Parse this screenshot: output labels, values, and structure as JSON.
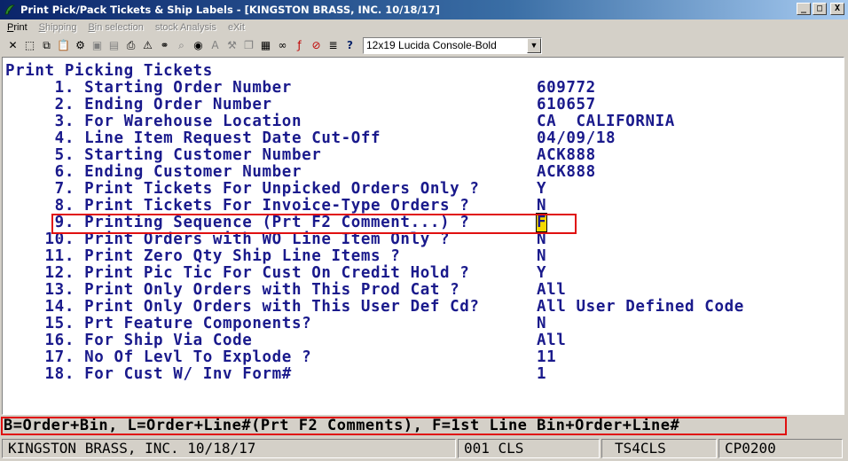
{
  "window": {
    "title": "Print Pick/Pack Tickets & Ship Labels - [KINGSTON BRASS, INC. 10/18/17]",
    "min": "_",
    "max": "□",
    "close": "X"
  },
  "menu": [
    {
      "label": "Print",
      "enabled": true
    },
    {
      "label": "Shipping",
      "enabled": false
    },
    {
      "label": "Bin selection",
      "enabled": false
    },
    {
      "label": "stock Analysis",
      "enabled": false
    },
    {
      "label": "eXit",
      "enabled": false
    }
  ],
  "toolbar": {
    "font_select_value": "12x19 Lucida Console-Bold",
    "buttons": [
      {
        "icon": "close-x-icon",
        "glyph": "✕"
      },
      {
        "icon": "select-box-icon",
        "glyph": "⬚"
      },
      {
        "icon": "copy-icon",
        "glyph": "⧉"
      },
      {
        "icon": "paste-icon",
        "glyph": "📋"
      },
      {
        "icon": "settings-gear-icon",
        "glyph": "⚙"
      },
      {
        "icon": "save-icon",
        "glyph": "▣"
      },
      {
        "icon": "document-icon",
        "glyph": "▤"
      },
      {
        "icon": "print-icon",
        "glyph": "⎙"
      },
      {
        "icon": "warning-icon",
        "glyph": "⚠"
      },
      {
        "icon": "binoculars-icon",
        "glyph": "⚭"
      },
      {
        "icon": "search-icon",
        "glyph": "⌕"
      },
      {
        "icon": "globe-icon",
        "glyph": "◉"
      },
      {
        "icon": "italic-font-icon",
        "glyph": "A"
      },
      {
        "icon": "tools-icon",
        "glyph": "⚒"
      },
      {
        "icon": "pages-icon",
        "glyph": "❐"
      },
      {
        "icon": "calculator-icon",
        "glyph": "▦"
      },
      {
        "icon": "link-icon",
        "glyph": "∞"
      },
      {
        "icon": "function-icon",
        "glyph": "ƒ"
      },
      {
        "icon": "no-entry-icon",
        "glyph": "⊘"
      },
      {
        "icon": "notes-icon",
        "glyph": "≣"
      },
      {
        "icon": "help-cursor-icon",
        "glyph": "?"
      }
    ]
  },
  "screen": {
    "heading": "Print Picking Tickets",
    "fields": [
      {
        "label": "     1. Starting Order Number",
        "value": "609772"
      },
      {
        "label": "     2. Ending Order Number",
        "value": "610657"
      },
      {
        "label": "     3. For Warehouse Location",
        "value": "CA  CALIFORNIA"
      },
      {
        "label": "     4. Line Item Request Date Cut-Off",
        "value": "04/09/18"
      },
      {
        "label": "     5. Starting Customer Number",
        "value": "ACK888"
      },
      {
        "label": "     6. Ending Customer Number",
        "value": "ACK888"
      },
      {
        "label": "     7. Print Tickets For Unpicked Orders Only ?",
        "value": "Y"
      },
      {
        "label": "     8. Print Tickets For Invoice-Type Orders ?",
        "value": "N"
      },
      {
        "label": "     9. Printing Sequence (Prt F2 Comment...) ?",
        "value": "F"
      },
      {
        "label": "    10. Print Orders with WO Line Item Only ?",
        "value": "N"
      },
      {
        "label": "    11. Print Zero Qty Ship Line Items ?",
        "value": "N"
      },
      {
        "label": "    12. Print Pic Tic For Cust On Credit Hold ?",
        "value": "Y"
      },
      {
        "label": "    13. Print Only Orders with This Prod Cat ?",
        "value": "All"
      },
      {
        "label": "    14. Print Only Orders with This User Def Cd?",
        "value": "All User Defined Code"
      },
      {
        "label": "    15. Prt Feature Components?",
        "value": "N"
      },
      {
        "label": "    16. For Ship Via Code",
        "value": "All"
      },
      {
        "label": "    17. No Of Levl To Explode ?",
        "value": "11"
      },
      {
        "label": "    18. For Cust W/ Inv Form#",
        "value": "1"
      }
    ],
    "help_line": "B=Order+Bin, L=Order+Line#(Prt F2 Comments), F=1st Line Bin+Order+Line#"
  },
  "status": {
    "company": "KINGSTON BRASS, INC. 10/18/17",
    "code": "001 CLS",
    "terminal": "TS4CLS",
    "program": "CP0200"
  },
  "colors": {
    "terminal_text": "#1a1a8c",
    "cursor": "#f5d800",
    "highlight": "#e01010"
  }
}
